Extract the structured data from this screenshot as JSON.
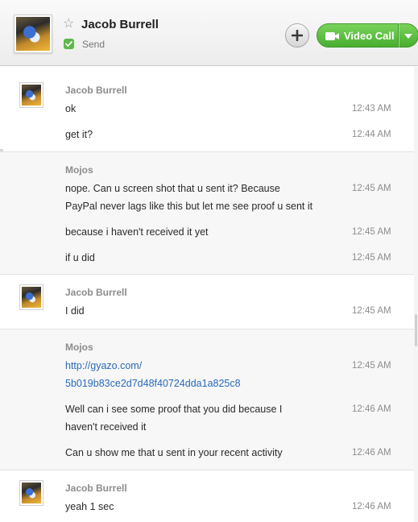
{
  "header": {
    "contact_name": "Jacob Burrell",
    "status_text": "Send",
    "video_call_label": "Video Call",
    "icons": {
      "favorite": "star-icon",
      "status": "check-icon",
      "add": "plus-icon",
      "video": "camera-icon",
      "dropdown": "chevron-down-icon"
    },
    "accent_green": "#5bb947"
  },
  "conversation": {
    "groups": [
      {
        "sender": "Jacob Burrell",
        "messages": [
          {
            "text": "ok",
            "time": "12:43 AM"
          },
          {
            "text": "get it?",
            "time": "12:44 AM"
          }
        ]
      },
      {
        "sender": "Mojos",
        "messages": [
          {
            "line1": "nope. Can u screen shot that u sent it? Because",
            "line2": "PayPal never lags like this but let me see proof u sent it",
            "time": "12:45 AM"
          },
          {
            "text": "because i haven't received it yet",
            "time": "12:45 AM"
          },
          {
            "text": "if u did",
            "time": "12:45 AM"
          }
        ]
      },
      {
        "sender": "Jacob Burrell",
        "messages": [
          {
            "text": "I did",
            "time": "12:45 AM"
          }
        ]
      },
      {
        "sender": "Mojos",
        "messages": [
          {
            "line1": "http://gyazo.com/",
            "line2": "5b019b83ce2d7d48f40724dda1a825c8",
            "time": "12:45 AM"
          },
          {
            "line1": "Well can i see some proof that you did because I",
            "line2": "haven't received it",
            "time": "12:46 AM"
          },
          {
            "text": "Can u show me that u sent in your recent activity",
            "time": "12:46 AM"
          }
        ]
      },
      {
        "sender": "Jacob Burrell",
        "messages": [
          {
            "text": "yeah 1 sec",
            "time": "12:46 AM"
          }
        ]
      }
    ]
  }
}
